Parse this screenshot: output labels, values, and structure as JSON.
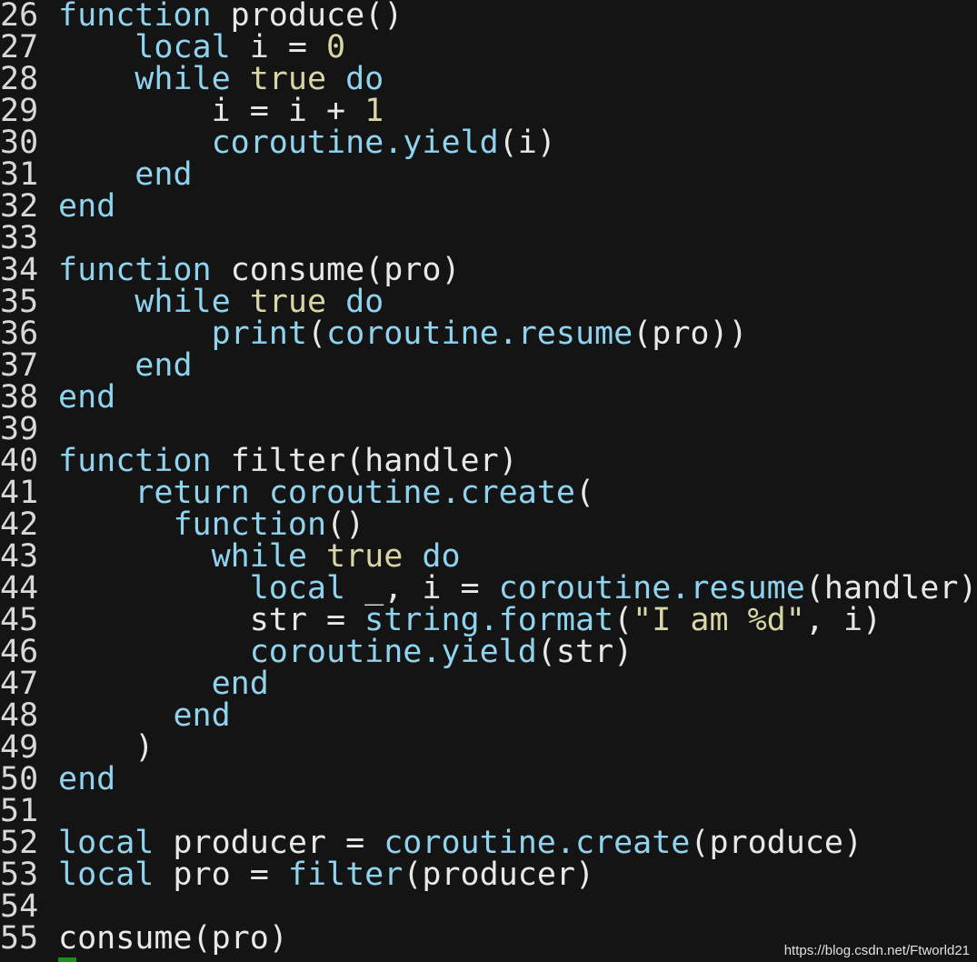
{
  "editor": {
    "colors": {
      "background": "#141414",
      "keyword": "#8fd3ef",
      "literal": "#d9d6a6",
      "plain": "#e8e8e8",
      "line_number": "#d8d8d8",
      "cursor": "#1c8c1c"
    },
    "lines": [
      {
        "n": "26",
        "tokens": [
          [
            "function",
            "kw"
          ],
          [
            " produce()",
            "plain"
          ]
        ]
      },
      {
        "n": "27",
        "tokens": [
          [
            "    ",
            "plain"
          ],
          [
            "local",
            "kw"
          ],
          [
            " i = ",
            "plain"
          ],
          [
            "0",
            "lit"
          ]
        ]
      },
      {
        "n": "28",
        "tokens": [
          [
            "    ",
            "plain"
          ],
          [
            "while",
            "kw"
          ],
          [
            " ",
            "plain"
          ],
          [
            "true",
            "lit"
          ],
          [
            " ",
            "plain"
          ],
          [
            "do",
            "kw"
          ]
        ]
      },
      {
        "n": "29",
        "tokens": [
          [
            "        i = i + ",
            "plain"
          ],
          [
            "1",
            "lit"
          ]
        ]
      },
      {
        "n": "30",
        "tokens": [
          [
            "        ",
            "plain"
          ],
          [
            "coroutine.yield",
            "fn"
          ],
          [
            "(i)",
            "plain"
          ]
        ]
      },
      {
        "n": "31",
        "tokens": [
          [
            "    ",
            "plain"
          ],
          [
            "end",
            "kw"
          ]
        ]
      },
      {
        "n": "32",
        "tokens": [
          [
            "end",
            "kw"
          ]
        ]
      },
      {
        "n": "33",
        "tokens": []
      },
      {
        "n": "34",
        "tokens": [
          [
            "function",
            "kw"
          ],
          [
            " consume(pro)",
            "plain"
          ]
        ]
      },
      {
        "n": "35",
        "tokens": [
          [
            "    ",
            "plain"
          ],
          [
            "while",
            "kw"
          ],
          [
            " ",
            "plain"
          ],
          [
            "true",
            "lit"
          ],
          [
            " ",
            "plain"
          ],
          [
            "do",
            "kw"
          ]
        ]
      },
      {
        "n": "36",
        "tokens": [
          [
            "        ",
            "plain"
          ],
          [
            "print",
            "fn"
          ],
          [
            "(",
            "plain"
          ],
          [
            "coroutine.resume",
            "fn"
          ],
          [
            "(pro))",
            "plain"
          ]
        ]
      },
      {
        "n": "37",
        "tokens": [
          [
            "    ",
            "plain"
          ],
          [
            "end",
            "kw"
          ]
        ]
      },
      {
        "n": "38",
        "tokens": [
          [
            "end",
            "kw"
          ]
        ]
      },
      {
        "n": "39",
        "tokens": []
      },
      {
        "n": "40",
        "tokens": [
          [
            "function",
            "kw"
          ],
          [
            " filter(handler)",
            "plain"
          ]
        ]
      },
      {
        "n": "41",
        "tokens": [
          [
            "    ",
            "plain"
          ],
          [
            "return",
            "kw"
          ],
          [
            " ",
            "plain"
          ],
          [
            "coroutine.create",
            "fn"
          ],
          [
            "(",
            "plain"
          ]
        ]
      },
      {
        "n": "42",
        "tokens": [
          [
            "      ",
            "plain"
          ],
          [
            "function",
            "kw"
          ],
          [
            "()",
            "plain"
          ]
        ]
      },
      {
        "n": "43",
        "tokens": [
          [
            "        ",
            "plain"
          ],
          [
            "while",
            "kw"
          ],
          [
            " ",
            "plain"
          ],
          [
            "true",
            "lit"
          ],
          [
            " ",
            "plain"
          ],
          [
            "do",
            "kw"
          ]
        ]
      },
      {
        "n": "44",
        "tokens": [
          [
            "          ",
            "plain"
          ],
          [
            "local",
            "kw"
          ],
          [
            " _, i = ",
            "plain"
          ],
          [
            "coroutine.resume",
            "fn"
          ],
          [
            "(handler)",
            "plain"
          ]
        ]
      },
      {
        "n": "45",
        "tokens": [
          [
            "          str = ",
            "plain"
          ],
          [
            "string.format",
            "fn"
          ],
          [
            "(",
            "plain"
          ],
          [
            "\"I am %d\"",
            "str"
          ],
          [
            ", i)",
            "plain"
          ]
        ]
      },
      {
        "n": "46",
        "tokens": [
          [
            "          ",
            "plain"
          ],
          [
            "coroutine.yield",
            "fn"
          ],
          [
            "(str)",
            "plain"
          ]
        ]
      },
      {
        "n": "47",
        "tokens": [
          [
            "        ",
            "plain"
          ],
          [
            "end",
            "kw"
          ]
        ]
      },
      {
        "n": "48",
        "tokens": [
          [
            "      ",
            "plain"
          ],
          [
            "end",
            "kw"
          ]
        ]
      },
      {
        "n": "49",
        "tokens": [
          [
            "    )",
            "plain"
          ]
        ]
      },
      {
        "n": "50",
        "tokens": [
          [
            "end",
            "kw"
          ]
        ]
      },
      {
        "n": "51",
        "tokens": []
      },
      {
        "n": "52",
        "tokens": [
          [
            "local",
            "kw"
          ],
          [
            " producer = ",
            "plain"
          ],
          [
            "coroutine.create",
            "fn"
          ],
          [
            "(produce)",
            "plain"
          ]
        ]
      },
      {
        "n": "53",
        "tokens": [
          [
            "local",
            "kw"
          ],
          [
            " pro = ",
            "plain"
          ],
          [
            "filter",
            "fn"
          ],
          [
            "(producer)",
            "plain"
          ]
        ]
      },
      {
        "n": "54",
        "tokens": []
      },
      {
        "n": "55",
        "tokens": [
          [
            "consume(pro)",
            "plain"
          ]
        ]
      }
    ]
  },
  "watermark": "https://blog.csdn.net/Ftworld21"
}
